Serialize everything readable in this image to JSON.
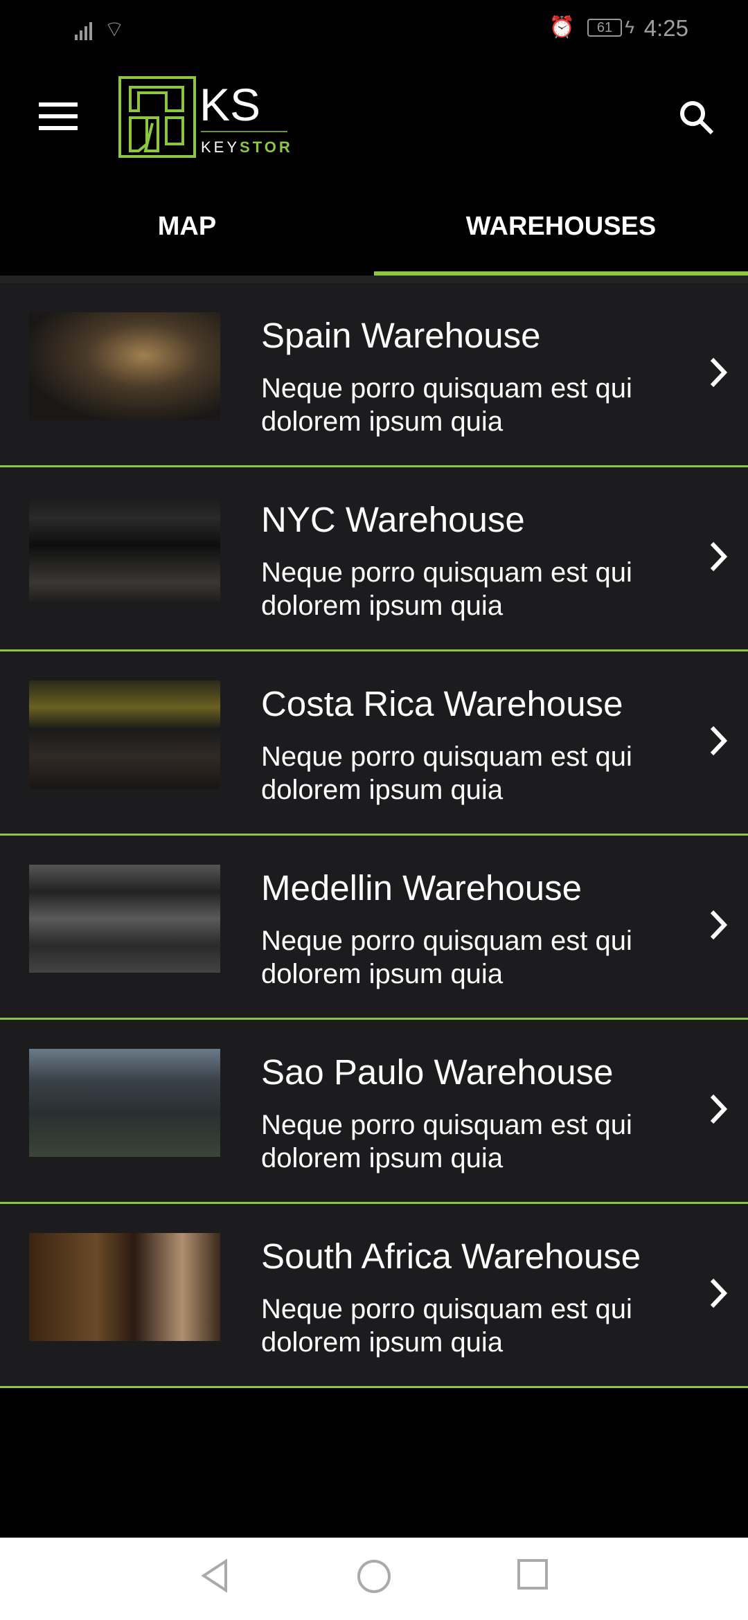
{
  "status_bar": {
    "time": "4:25",
    "battery": "61",
    "icons": [
      "signal-icon",
      "wifi-icon",
      "alarm-icon",
      "battery-icon",
      "charging-icon"
    ]
  },
  "header": {
    "logo_letters": "KS",
    "logo_word_a": "KEY",
    "logo_word_b": "STOR",
    "menu_icon": "hamburger-icon",
    "search_icon": "search-icon"
  },
  "tabs": [
    {
      "label": "MAP",
      "active": false
    },
    {
      "label": "WAREHOUSES",
      "active": true
    }
  ],
  "colors": {
    "accent": "#8dc63f",
    "row_bg": "#1c1c1e",
    "background": "#000000"
  },
  "warehouses": [
    {
      "title": "Spain Warehouse",
      "description": "Neque porro quisquam est qui dolorem ipsum quia"
    },
    {
      "title": "NYC Warehouse",
      "description": "Neque porro quisquam est qui dolorem ipsum quia"
    },
    {
      "title": "Costa Rica Warehouse",
      "description": "Neque porro quisquam est qui dolorem ipsum quia"
    },
    {
      "title": "Medellin Warehouse",
      "description": "Neque porro quisquam est qui dolorem ipsum quia"
    },
    {
      "title": "Sao Paulo Warehouse",
      "description": "Neque porro quisquam est qui dolorem ipsum quia"
    },
    {
      "title": "South Africa Warehouse",
      "description": "Neque porro quisquam est qui dolorem ipsum quia"
    }
  ],
  "nav_bar": {
    "icons": [
      "back-icon",
      "home-icon",
      "recents-icon"
    ]
  }
}
